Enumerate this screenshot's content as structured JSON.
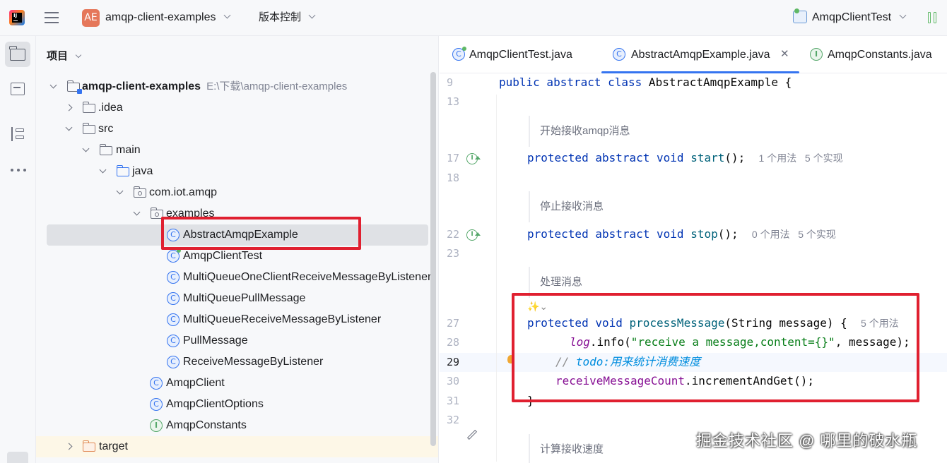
{
  "topbar": {
    "app_icon_text": "IJ",
    "project_badge": "AE",
    "project_name": "amqp-client-examples",
    "vcs_label": "版本控制",
    "run_config": "AmqpClientTest"
  },
  "sidebar": {
    "icons": [
      "folder-icon",
      "commit-icon",
      "structure-icon",
      "more-icon"
    ]
  },
  "project_panel": {
    "title": "项目",
    "root": {
      "name": "amqp-client-examples",
      "path": "E:\\下载\\amqp-client-examples"
    },
    "rows": [
      {
        "label": ".idea",
        "icon": "folder-icon"
      },
      {
        "label": "src",
        "icon": "folder-icon"
      },
      {
        "label": "main",
        "icon": "folder-icon"
      },
      {
        "label": "java",
        "icon": "source-folder-icon"
      },
      {
        "label": "com.iot.amqp",
        "icon": "package-icon"
      },
      {
        "label": "examples",
        "icon": "package-icon"
      },
      {
        "label": "AbstractAmqpExample",
        "icon": "abstract-class-icon"
      },
      {
        "label": "AmqpClientTest",
        "icon": "runnable-class-icon"
      },
      {
        "label": "MultiQueueOneClientReceiveMessageByListener",
        "icon": "class-icon"
      },
      {
        "label": "MultiQueuePullMessage",
        "icon": "class-icon"
      },
      {
        "label": "MultiQueueReceiveMessageByListener",
        "icon": "class-icon"
      },
      {
        "label": "PullMessage",
        "icon": "class-icon"
      },
      {
        "label": "ReceiveMessageByListener",
        "icon": "class-icon"
      },
      {
        "label": "AmqpClient",
        "icon": "class-icon"
      },
      {
        "label": "AmqpClientOptions",
        "icon": "class-icon"
      },
      {
        "label": "AmqpConstants",
        "icon": "interface-icon"
      },
      {
        "label": "target",
        "icon": "excluded-folder-icon"
      }
    ],
    "selected": "AbstractAmqpExample"
  },
  "tabs": [
    {
      "label": "AmqpClientTest.java",
      "active": false
    },
    {
      "label": "AbstractAmqpExample.java",
      "active": true
    },
    {
      "label": "AmqpConstants.java",
      "active": false
    }
  ],
  "tab_close": "✕",
  "editor": {
    "line_numbers": [
      "9",
      "13",
      "17",
      "18",
      "22",
      "23",
      "27",
      "28",
      "29",
      "30",
      "31",
      "32"
    ],
    "current_line": "29",
    "code": {
      "l9_kw": "public abstract class",
      "l9_rest": " AbstractAmqpExample {",
      "doc_start": "开始接收amqp消息",
      "l17_kw": "protected abstract void",
      "l17_fn": "start",
      "l17_rest": "();",
      "l17_hint": "1 个用法   5 个实现",
      "doc_stop": "停止接收消息",
      "l22_kw": "protected abstract void",
      "l22_fn": "stop",
      "l22_rest": "();",
      "l22_hint": "0 个用法   5 个实现",
      "doc_process": "处理消息",
      "l27_kw": "protected void",
      "l27_fn": "processMessage",
      "l27_rest": "(String message) {",
      "l27_hint": "5 个用法",
      "l28_fld": "log",
      "l28_a": ".info(",
      "l28_str": "\"receive a message,content={}\"",
      "l28_b": ", message);",
      "l29_cm": "// ",
      "l29_todo": "todo:用来统计消费速度",
      "l30_fld": "receiveMessageCount",
      "l30_rest": ".incrementAndGet();",
      "l31": "}",
      "doc_calc": "计算接收速度"
    }
  },
  "watermark": "掘金技术社区 @ 哪里的破水瓶",
  "colors": {
    "annotation_red": "#e02030",
    "accent_blue": "#3574f0",
    "keyword": "#0033b3",
    "method": "#00627a",
    "field": "#871094",
    "string": "#067d17"
  }
}
